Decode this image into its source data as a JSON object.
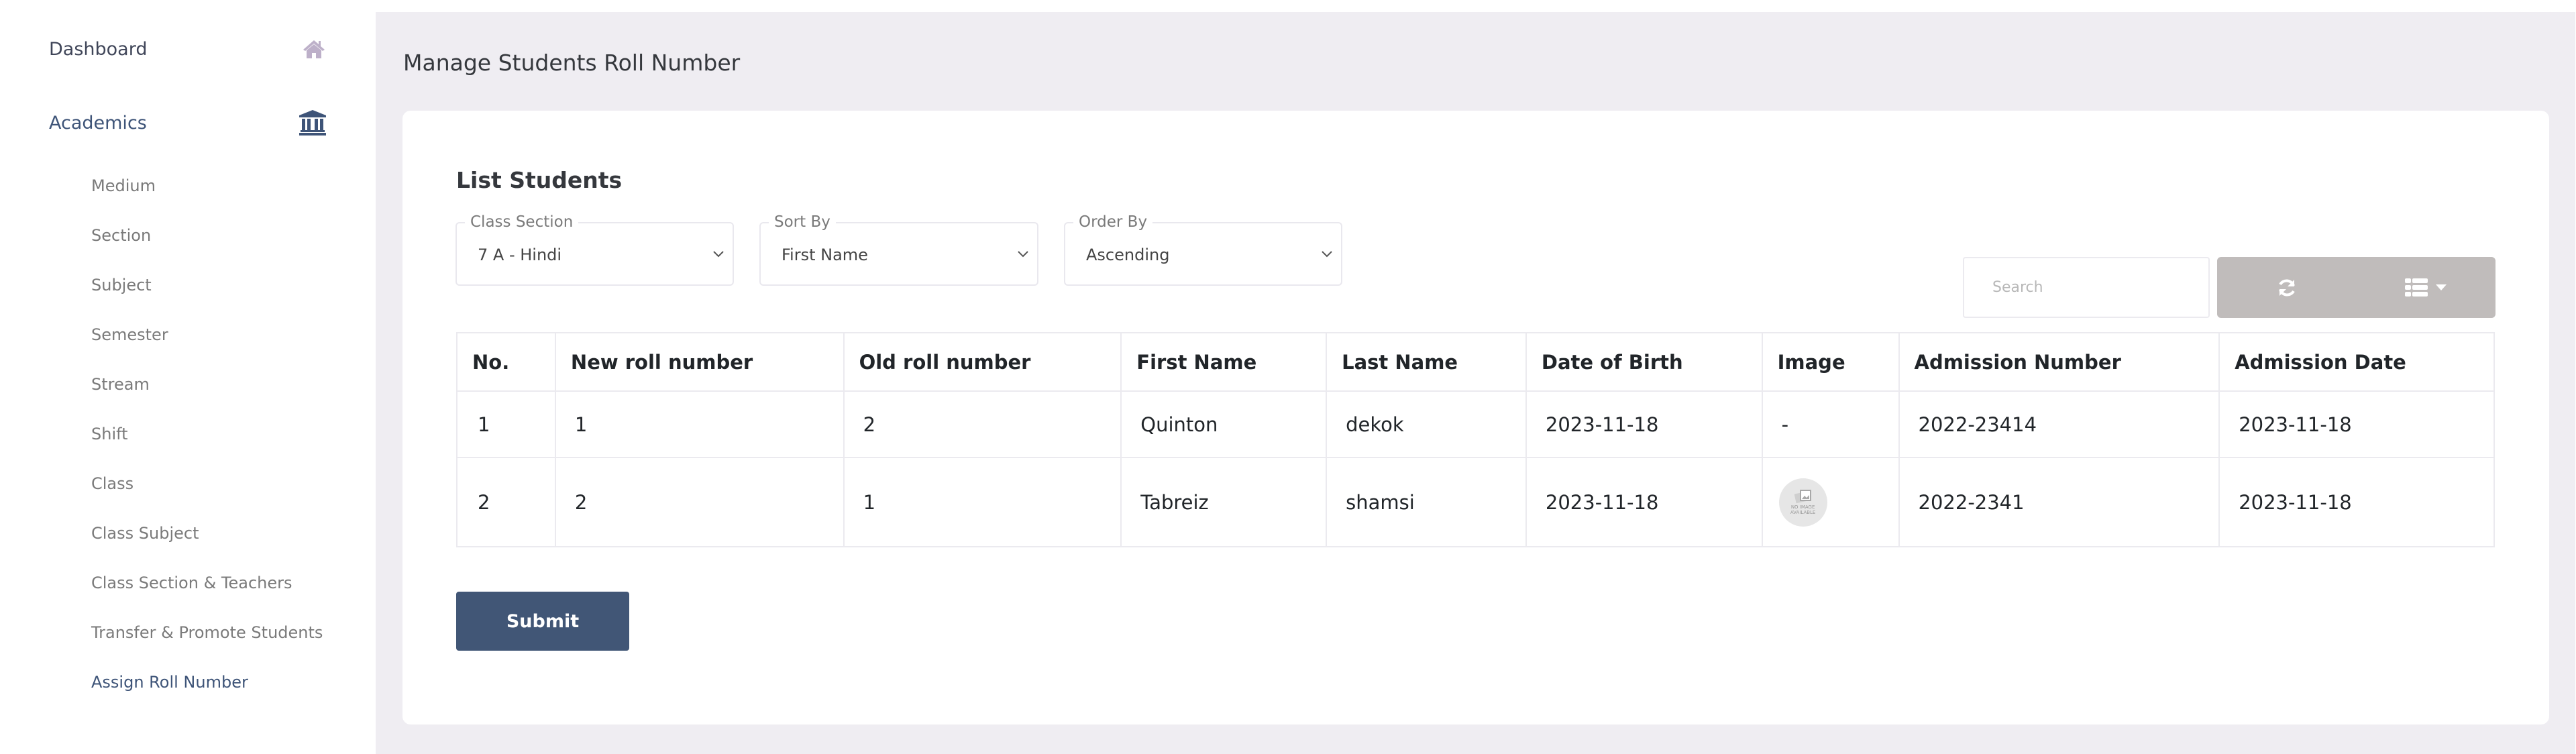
{
  "sidebar": {
    "dashboard": {
      "label": "Dashboard",
      "icon": "home-icon"
    },
    "academics": {
      "label": "Academics",
      "icon": "bank-icon"
    },
    "items": [
      {
        "label": "Medium"
      },
      {
        "label": "Section"
      },
      {
        "label": "Subject"
      },
      {
        "label": "Semester"
      },
      {
        "label": "Stream"
      },
      {
        "label": "Shift"
      },
      {
        "label": "Class"
      },
      {
        "label": "Class Subject"
      },
      {
        "label": "Class Section & Teachers"
      },
      {
        "label": "Transfer & Promote Students"
      },
      {
        "label": "Assign Roll Number",
        "active": true
      }
    ]
  },
  "page": {
    "title": "Manage Students Roll Number",
    "card_title": "List Students"
  },
  "filters": {
    "class_section": {
      "label": "Class Section",
      "value": "7 A - Hindi"
    },
    "sort_by": {
      "label": "Sort By",
      "value": "First Name"
    },
    "order_by": {
      "label": "Order By",
      "value": "Ascending"
    }
  },
  "toolbar": {
    "search_placeholder": "Search",
    "refresh_icon": "refresh-icon",
    "columns_icon": "list-icon"
  },
  "table": {
    "headers": [
      "No.",
      "New roll number",
      "Old roll number",
      "First Name",
      "Last Name",
      "Date of Birth",
      "Image",
      "Admission Number",
      "Admission Date"
    ],
    "rows": [
      {
        "no": "1",
        "new_roll": "1",
        "old_roll": "2",
        "first_name": "Quinton",
        "last_name": "dekok",
        "dob": "2023-11-18",
        "image": "-",
        "admission_number": "2022-23414",
        "admission_date": "2023-11-18"
      },
      {
        "no": "2",
        "new_roll": "2",
        "old_roll": "1",
        "first_name": "Tabreiz",
        "last_name": "shamsi",
        "dob": "2023-11-18",
        "image": "NO IMAGE AVAILABLE",
        "admission_number": "2022-2341",
        "admission_date": "2023-11-18"
      }
    ]
  },
  "submit_label": "Submit",
  "colors": {
    "primary": "#415676",
    "background": "#efedf2",
    "toolbar_button": "#c0bcbb",
    "active_nav": "#3e5478"
  }
}
